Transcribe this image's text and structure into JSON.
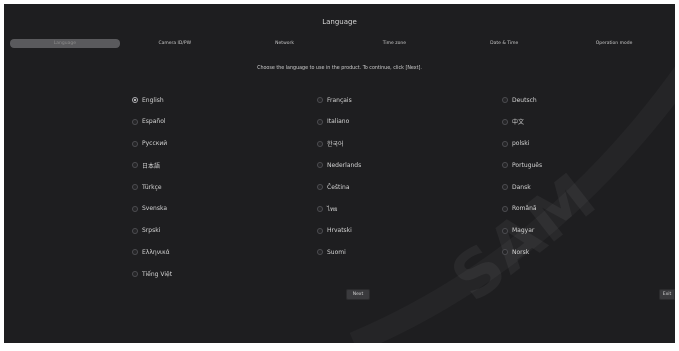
{
  "header": {
    "title": "Language"
  },
  "steps": [
    {
      "label": "Language",
      "active": true
    },
    {
      "label": "Camera ID/PW",
      "active": false
    },
    {
      "label": "Network",
      "active": false
    },
    {
      "label": "Time zone",
      "active": false
    },
    {
      "label": "Date & Time",
      "active": false
    },
    {
      "label": "Operation mode",
      "active": false
    }
  ],
  "instruction": "Choose the language to use in the product. To continue, click [Next].",
  "languages": [
    {
      "label": "English",
      "selected": true
    },
    {
      "label": "Français",
      "selected": false
    },
    {
      "label": "Deutsch",
      "selected": false
    },
    {
      "label": "Español",
      "selected": false
    },
    {
      "label": "Italiano",
      "selected": false
    },
    {
      "label": "中文",
      "selected": false
    },
    {
      "label": "Русский",
      "selected": false
    },
    {
      "label": "한국어",
      "selected": false
    },
    {
      "label": "polski",
      "selected": false
    },
    {
      "label": "日本語",
      "selected": false
    },
    {
      "label": "Nederlands",
      "selected": false
    },
    {
      "label": "Português",
      "selected": false
    },
    {
      "label": "Türkçe",
      "selected": false
    },
    {
      "label": "Čeština",
      "selected": false
    },
    {
      "label": "Dansk",
      "selected": false
    },
    {
      "label": "Svenska",
      "selected": false
    },
    {
      "label": "ไทย",
      "selected": false
    },
    {
      "label": "Română",
      "selected": false
    },
    {
      "label": "Srpski",
      "selected": false
    },
    {
      "label": "Hrvatski",
      "selected": false
    },
    {
      "label": "Magyar",
      "selected": false
    },
    {
      "label": "Ελληνικά",
      "selected": false
    },
    {
      "label": "Suomi",
      "selected": false
    },
    {
      "label": "Norsk",
      "selected": false
    },
    {
      "label": "Tiếng Việt",
      "selected": false
    }
  ],
  "buttons": {
    "next": "Next",
    "exit": "Exit"
  },
  "watermark": {
    "text": "SAM",
    "color": "#ffffff"
  },
  "colors": {
    "background": "#1e1e20",
    "active_step": "#5a5a5d"
  }
}
